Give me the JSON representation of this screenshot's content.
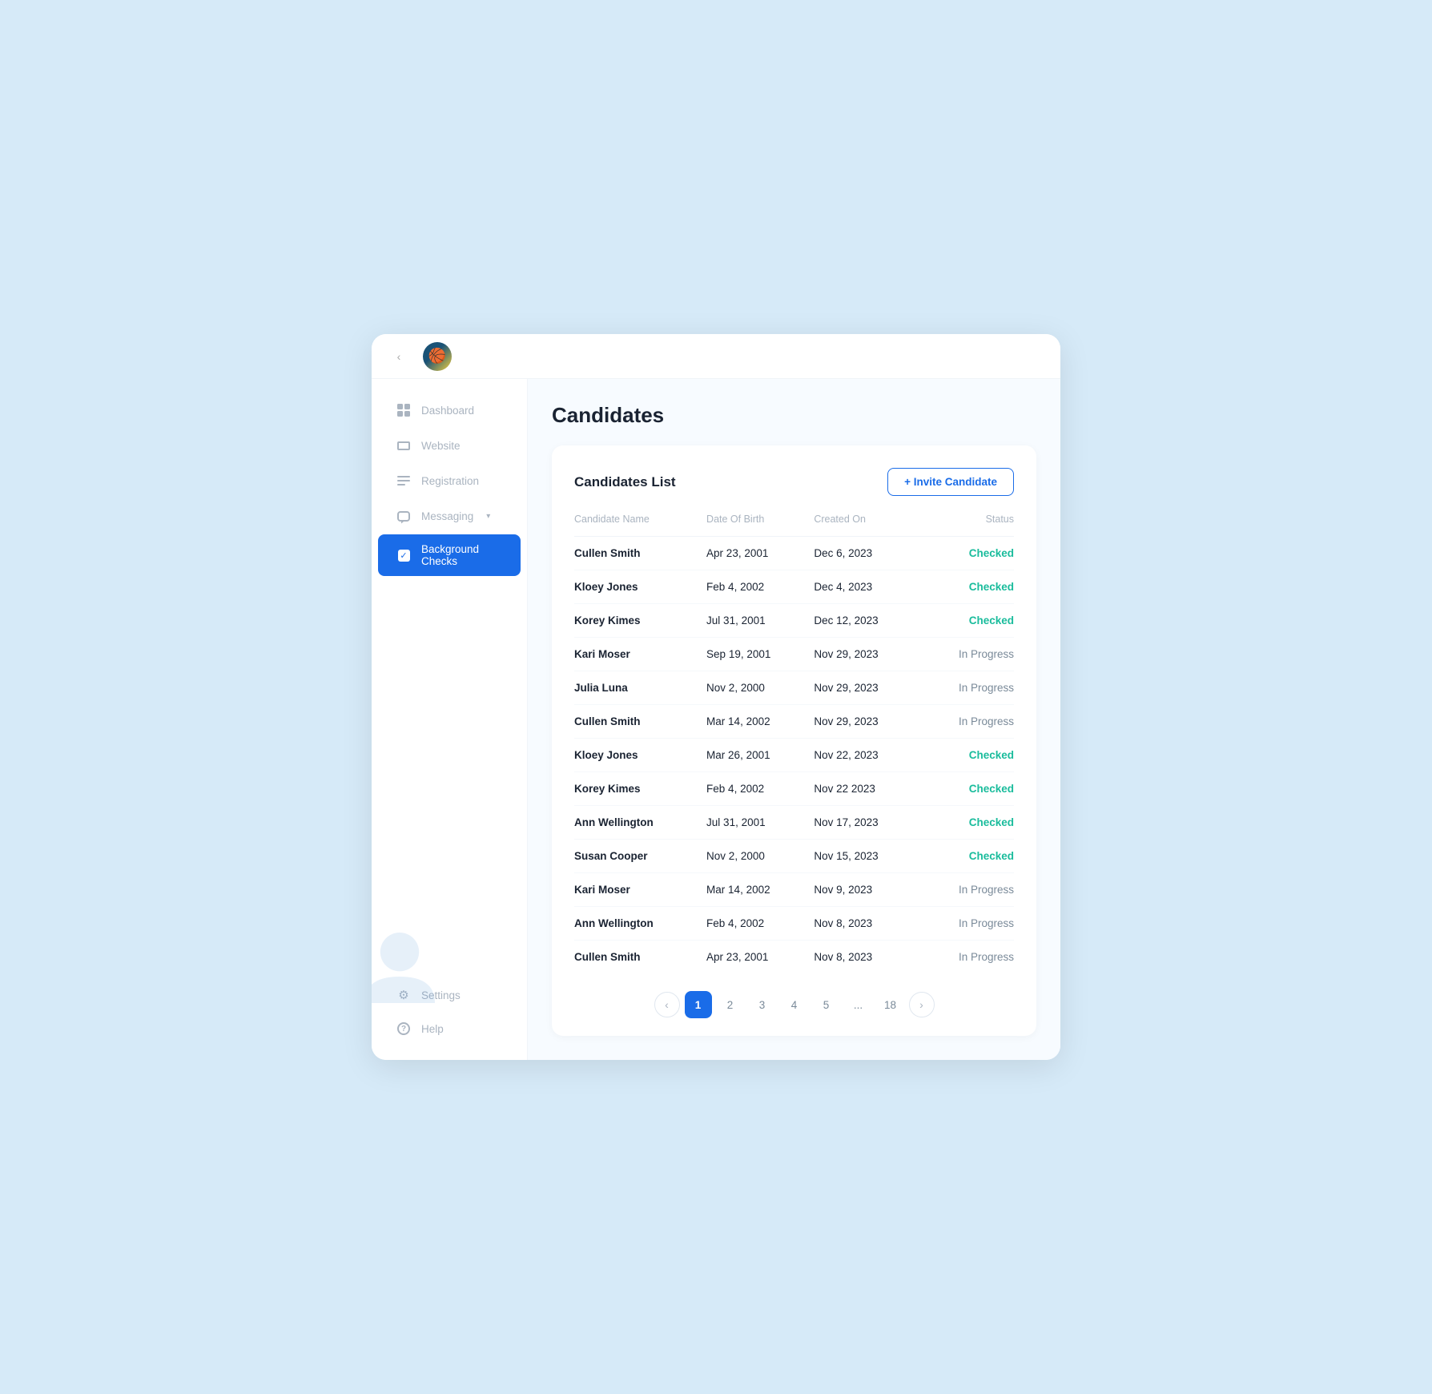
{
  "topbar": {
    "collapse_symbol": "‹",
    "logo_emoji": "🏀"
  },
  "sidebar": {
    "items": [
      {
        "id": "dashboard",
        "label": "Dashboard",
        "icon": "grid-icon",
        "active": false
      },
      {
        "id": "website",
        "label": "Website",
        "icon": "website-icon",
        "active": false
      },
      {
        "id": "registration",
        "label": "Registration",
        "icon": "registration-icon",
        "active": false
      },
      {
        "id": "messaging",
        "label": "Messaging",
        "icon": "messaging-icon",
        "active": false,
        "hasArrow": true
      },
      {
        "id": "background-checks",
        "label": "Background Checks",
        "icon": "checkbox-icon",
        "active": true
      },
      {
        "id": "settings",
        "label": "Settings",
        "icon": "settings-icon",
        "active": false
      },
      {
        "id": "help",
        "label": "Help",
        "icon": "help-icon",
        "active": false
      }
    ]
  },
  "page": {
    "title": "Candidates"
  },
  "card": {
    "title": "Candidates List",
    "invite_button": "+ Invite Candidate"
  },
  "table": {
    "columns": [
      "Candidate Name",
      "Date Of Birth",
      "Created On",
      "Status"
    ],
    "rows": [
      {
        "name": "Cullen Smith",
        "dob": "Apr 23, 2001",
        "created": "Dec 6, 2023",
        "status": "Checked",
        "status_type": "checked"
      },
      {
        "name": "Kloey Jones",
        "dob": "Feb 4, 2002",
        "created": "Dec 4, 2023",
        "status": "Checked",
        "status_type": "checked"
      },
      {
        "name": "Korey Kimes",
        "dob": "Jul 31, 2001",
        "created": "Dec 12, 2023",
        "status": "Checked",
        "status_type": "checked"
      },
      {
        "name": "Kari Moser",
        "dob": "Sep 19, 2001",
        "created": "Nov 29, 2023",
        "status": "In Progress",
        "status_type": "inprogress"
      },
      {
        "name": "Julia Luna",
        "dob": "Nov 2, 2000",
        "created": "Nov 29, 2023",
        "status": "In Progress",
        "status_type": "inprogress"
      },
      {
        "name": "Cullen Smith",
        "dob": "Mar 14, 2002",
        "created": "Nov 29, 2023",
        "status": "In Progress",
        "status_type": "inprogress"
      },
      {
        "name": "Kloey Jones",
        "dob": "Mar 26, 2001",
        "created": "Nov 22, 2023",
        "status": "Checked",
        "status_type": "checked"
      },
      {
        "name": "Korey Kimes",
        "dob": "Feb 4, 2002",
        "created": "Nov 22 2023",
        "status": "Checked",
        "status_type": "checked"
      },
      {
        "name": "Ann Wellington",
        "dob": "Jul 31, 2001",
        "created": "Nov 17, 2023",
        "status": "Checked",
        "status_type": "checked"
      },
      {
        "name": "Susan Cooper",
        "dob": "Nov 2, 2000",
        "created": "Nov 15, 2023",
        "status": "Checked",
        "status_type": "checked"
      },
      {
        "name": "Kari Moser",
        "dob": "Mar 14, 2002",
        "created": "Nov 9, 2023",
        "status": "In Progress",
        "status_type": "inprogress"
      },
      {
        "name": "Ann Wellington",
        "dob": "Feb 4, 2002",
        "created": "Nov 8, 2023",
        "status": "In Progress",
        "status_type": "inprogress"
      },
      {
        "name": "Cullen Smith",
        "dob": "Apr 23, 2001",
        "created": "Nov 8, 2023",
        "status": "In Progress",
        "status_type": "inprogress"
      }
    ]
  },
  "pagination": {
    "prev_label": "‹",
    "next_label": "›",
    "pages": [
      "1",
      "2",
      "3",
      "4",
      "5",
      "...",
      "18"
    ],
    "active_page": "1"
  }
}
